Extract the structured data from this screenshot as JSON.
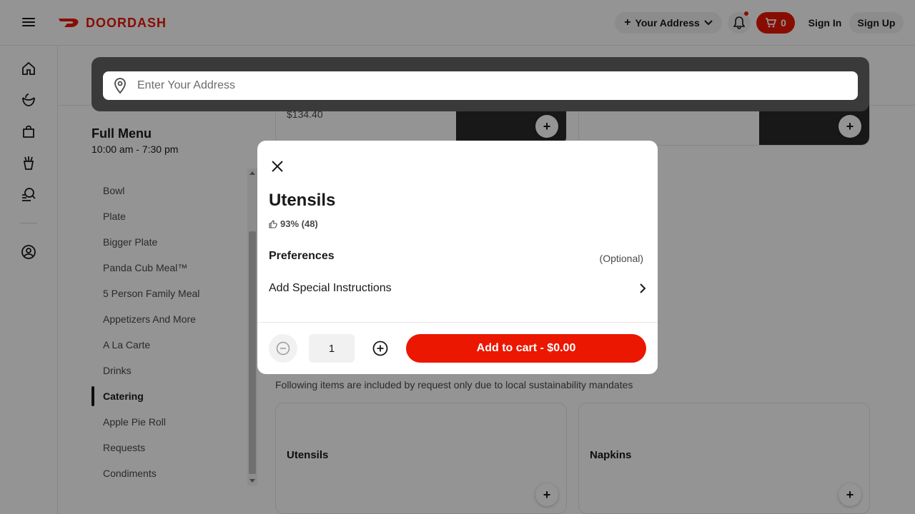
{
  "header": {
    "logo_text": "DOORDASH",
    "address_label": "Your Address",
    "cart_count": "0",
    "sign_in": "Sign In",
    "sign_up": "Sign Up",
    "accent_color": "#eb1700"
  },
  "rail": {
    "icons": [
      "home-icon",
      "grocery-icon",
      "retail-icon",
      "offers-icon",
      "browse-icon",
      "account-icon"
    ]
  },
  "address_panel": {
    "placeholder": "Enter Your Address"
  },
  "menu": {
    "title": "Full Menu",
    "hours": "10:00 am - 7:30 pm",
    "items": [
      {
        "label": "Bowl"
      },
      {
        "label": "Plate"
      },
      {
        "label": "Bigger Plate"
      },
      {
        "label": "Panda Cub Meal™"
      },
      {
        "label": "5 Person Family Meal"
      },
      {
        "label": "Appetizers And More"
      },
      {
        "label": "A La Carte"
      },
      {
        "label": "Drinks"
      },
      {
        "label": "Catering",
        "active": true
      },
      {
        "label": "Apple Pie Roll"
      },
      {
        "label": "Requests"
      },
      {
        "label": "Condiments"
      }
    ]
  },
  "catalog": {
    "top_card_price": "$134.40",
    "requests_section": {
      "subtitle": "Following items are included by request only due to local sustainability mandates",
      "items": [
        {
          "name": "Utensils"
        },
        {
          "name": "Napkins"
        }
      ]
    }
  },
  "modal": {
    "title": "Utensils",
    "rating": "93% (48)",
    "preferences_title": "Preferences",
    "preferences_optional": "(Optional)",
    "special_instructions": "Add Special Instructions",
    "quantity": "1",
    "add_to_cart": "Add to cart - $0.00"
  }
}
